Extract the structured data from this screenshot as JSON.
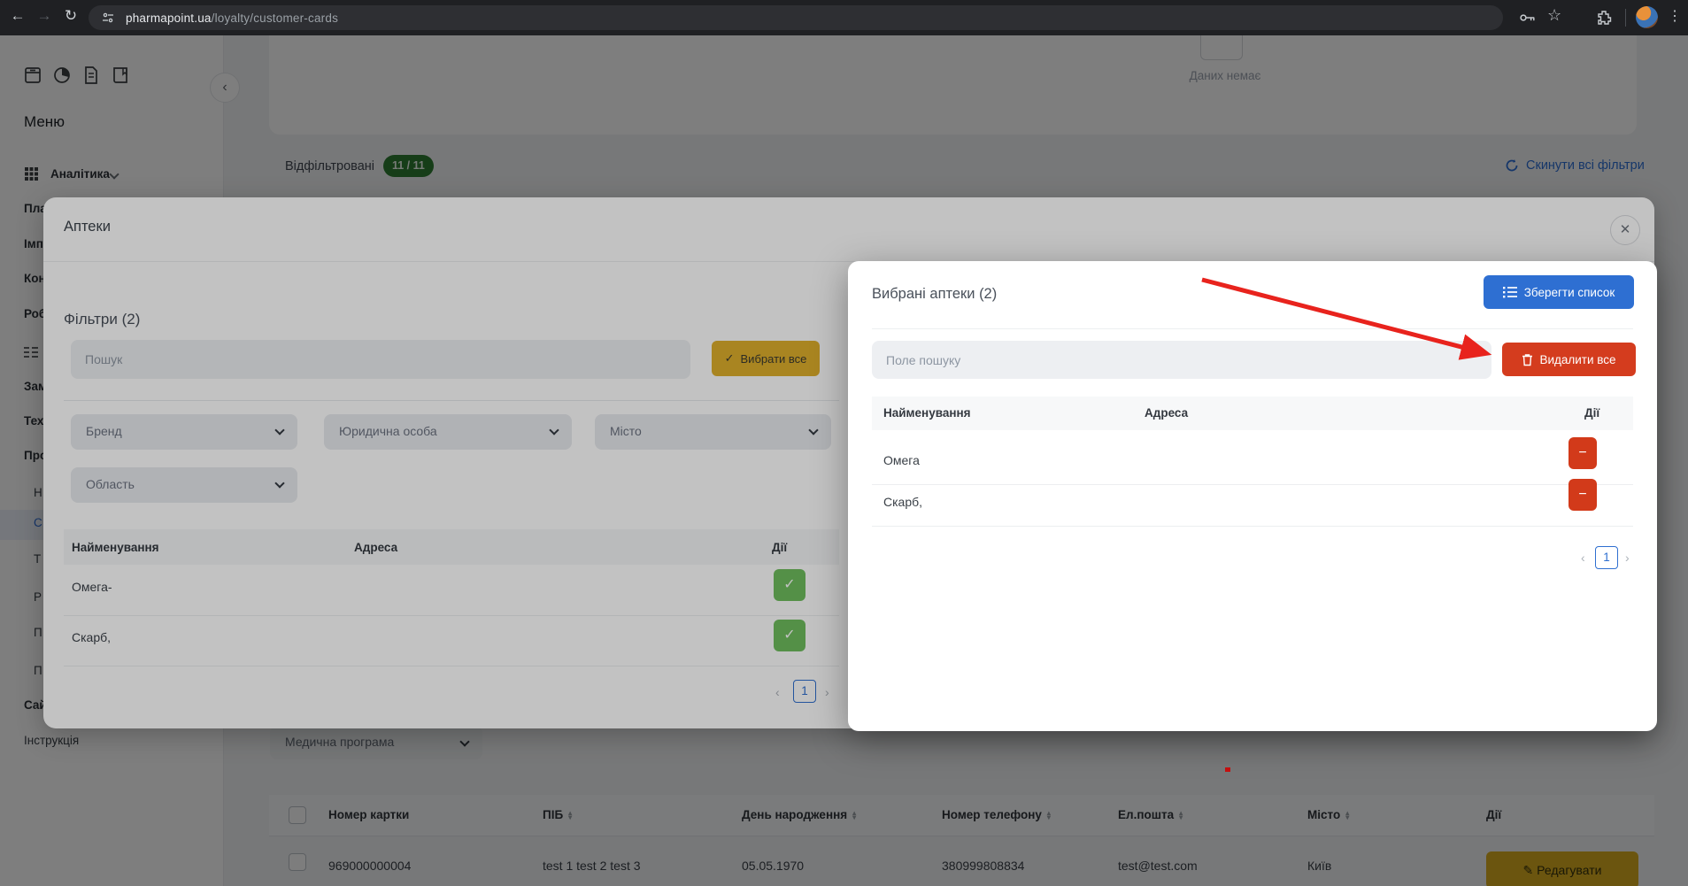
{
  "browser": {
    "url_host": "pharmapoint.ua",
    "url_path": "/loyalty/customer-cards"
  },
  "sidebar": {
    "menu_title": "Меню",
    "analytics_label": "Аналітика",
    "items": [
      {
        "label": "Пла"
      },
      {
        "label": "Імп"
      },
      {
        "label": "Кон"
      },
      {
        "label": "Роб"
      },
      {
        "label": "Зам"
      },
      {
        "label": "Тех"
      },
      {
        "label": "Про"
      }
    ],
    "sub_items": [
      {
        "label": "Н"
      },
      {
        "label": "С"
      },
      {
        "label": "Т"
      },
      {
        "label": "Р"
      },
      {
        "label": "П"
      },
      {
        "label": "П"
      }
    ],
    "site_label": "Сай",
    "instruction_label": "Інструкція"
  },
  "background": {
    "empty_text": "Даних немає",
    "filtered_label": "Відфільтровані",
    "filtered_badge": "11 / 11",
    "reset_filters_label": "Скинути всі фільтри",
    "med_program_label": "Медична програма",
    "table": {
      "headers": [
        "Номер картки",
        "ПІБ",
        "День народження",
        "Номер телефону",
        "Ел.пошта",
        "Місто",
        "Дії"
      ],
      "row": {
        "card_number": "969000000004",
        "name": "test 1 test 2 test 3",
        "birthday": "05.05.1970",
        "phone": "380999808834",
        "email": "test@test.com",
        "city": "Київ"
      },
      "edit_label": "Редагувати"
    }
  },
  "modal": {
    "title": "Аптеки",
    "filters_title": "Фільтри (2)",
    "search_placeholder": "Пошук",
    "select_all_label": "Вибрати все",
    "dropdowns": [
      {
        "label": "Бренд"
      },
      {
        "label": "Юридична особа"
      },
      {
        "label": "Місто"
      },
      {
        "label": "Область"
      }
    ],
    "table_headers": [
      "Найменування",
      "Адреса",
      "Дії"
    ],
    "rows": [
      {
        "name": "Омега-"
      },
      {
        "name": "Скарб,"
      }
    ],
    "page": "1"
  },
  "panel": {
    "title": "Вибрані аптеки (2)",
    "save_list_label": "Зберегти список",
    "search_placeholder": "Поле пошуку",
    "delete_all_label": "Видалити все",
    "table_headers": [
      "Найменування",
      "Адреса",
      "Дії"
    ],
    "rows": [
      {
        "name": "Омега"
      },
      {
        "name": "Скарб,"
      }
    ],
    "page": "1"
  },
  "colors": {
    "accent_yellow": "#dfaf2c",
    "green": "#6fbe5e",
    "blue": "#2e6fd2",
    "red": "#d43c1e",
    "link_blue": "#2c6fd6",
    "badge_green": "#2f7d32",
    "arrow_red": "#e8231d"
  }
}
